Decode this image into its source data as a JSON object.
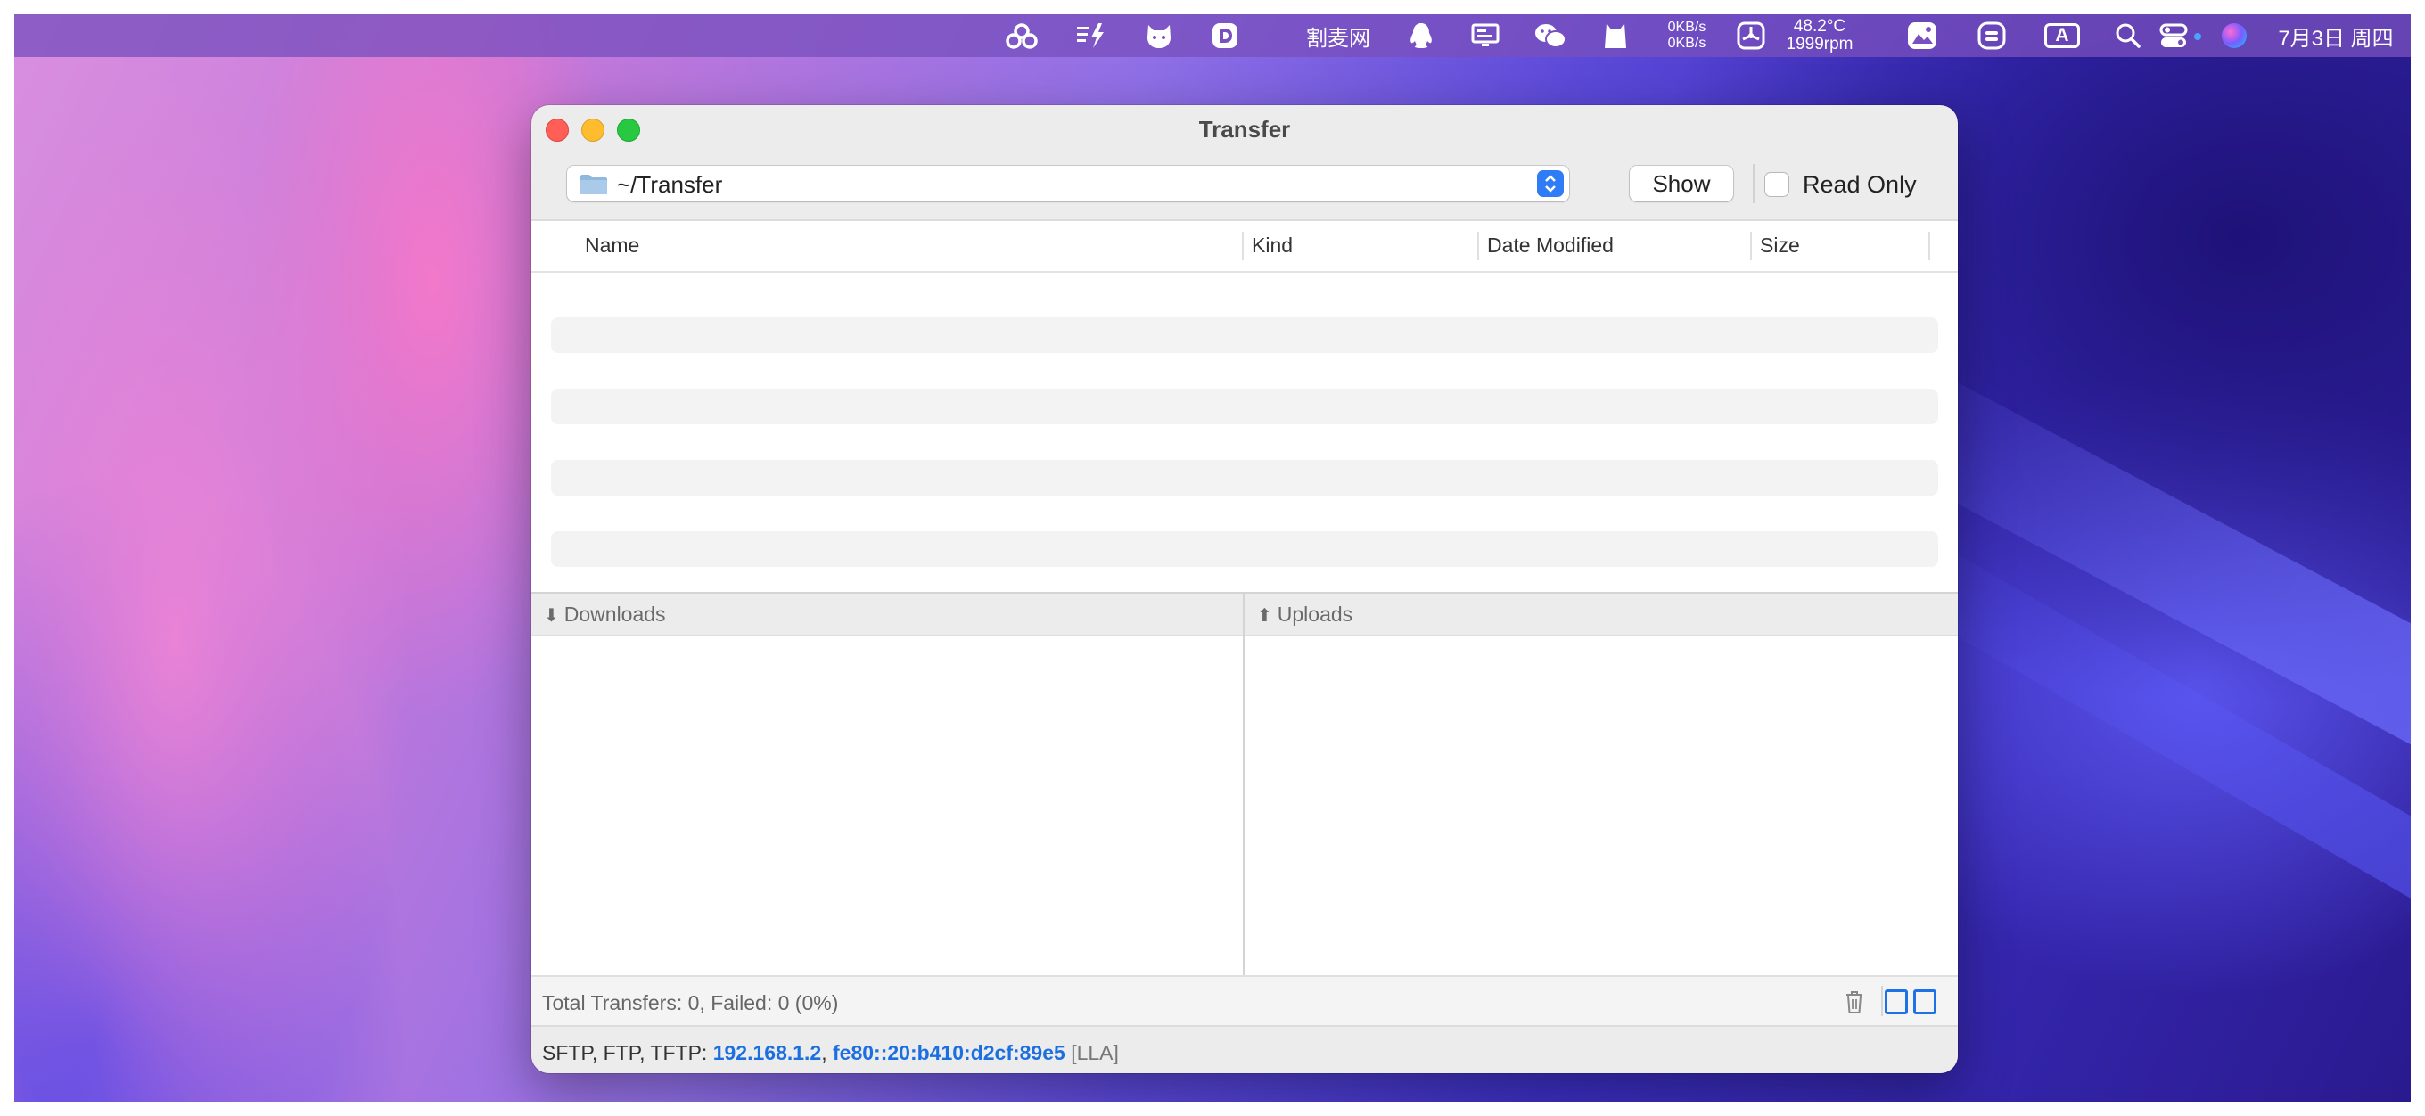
{
  "menubar": {
    "text_item": "割麦网",
    "net_up": "0KB/s",
    "net_down": "0KB/s",
    "temperature": "48.2°C",
    "fan": "1999rpm",
    "input_method": "A",
    "clock": "7月3日 周四"
  },
  "window": {
    "title": "Transfer",
    "path": "~/Transfer",
    "show_label": "Show",
    "read_only_label": "Read Only",
    "columns": [
      "Name",
      "Kind",
      "Date Modified",
      "Size"
    ],
    "downloads_label": "Downloads",
    "uploads_label": "Uploads",
    "status_text": "Total Transfers: 0, Failed: 0 (0%)",
    "footer": {
      "prefix": "SFTP, FTP, TFTP: ",
      "ipv4": "192.168.1.2",
      "comma": ", ",
      "ipv6": "fe80::20:b410:d2cf:89e5",
      "suffix": " [LLA]"
    }
  },
  "colors": {
    "accent": "#2f7cf6",
    "link": "#1b6fe0"
  }
}
